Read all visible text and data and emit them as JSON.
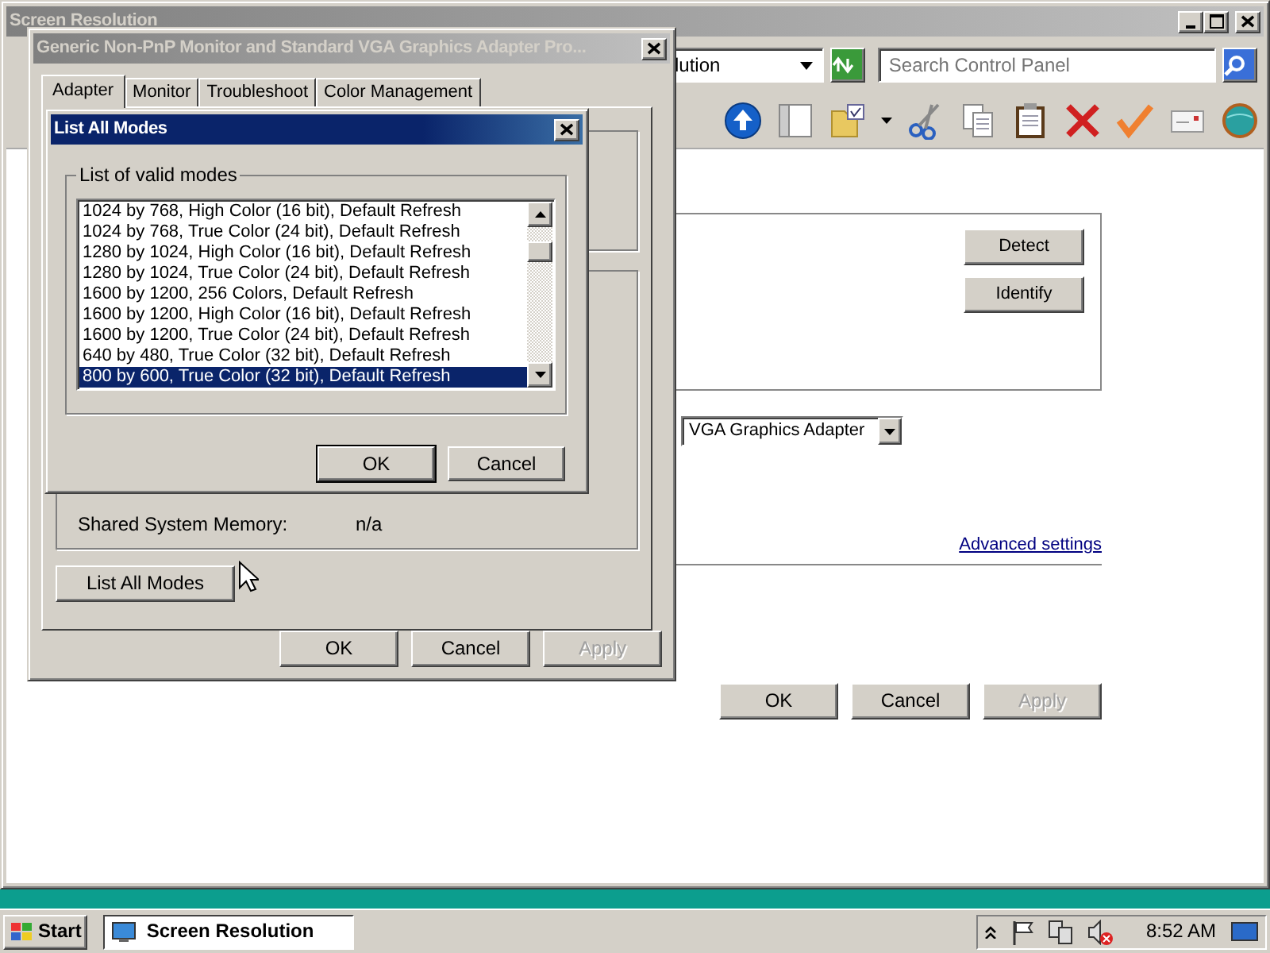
{
  "main_window": {
    "title": "Screen Resolution",
    "active": false,
    "address": "lution",
    "search": {
      "placeholder": "Search Control Panel"
    },
    "detect_button": "Detect",
    "identify_button": "Identify",
    "adapter_dropdown": "VGA Graphics Adapter",
    "advanced_link": "Advanced settings",
    "buttons": [
      {
        "label": "OK",
        "disabled": false
      },
      {
        "label": "Cancel",
        "disabled": false
      },
      {
        "label": "Apply",
        "disabled": true
      }
    ]
  },
  "properties_dialog": {
    "title": "Generic Non-PnP Monitor and Standard VGA Graphics Adapter Pro...",
    "active": false,
    "tabs": [
      {
        "label": "Adapter",
        "selected": true
      },
      {
        "label": "Monitor",
        "selected": false
      },
      {
        "label": "Troubleshoot",
        "selected": false
      },
      {
        "label": "Color Management",
        "selected": false
      }
    ],
    "info": [
      {
        "label": "Shared System Memory:",
        "value": "n/a"
      }
    ],
    "list_modes_button": "List All Modes",
    "buttons": [
      {
        "label": "OK",
        "disabled": false
      },
      {
        "label": "Cancel",
        "disabled": false
      },
      {
        "label": "Apply",
        "disabled": true
      }
    ]
  },
  "modes_dialog": {
    "title": "List All Modes",
    "active": true,
    "group_label": "List of valid modes",
    "modes": [
      {
        "label": "1024 by 768, High Color (16 bit), Default Refresh",
        "selected": false
      },
      {
        "label": "1024 by 768, True Color (24 bit), Default Refresh",
        "selected": false
      },
      {
        "label": "1280 by 1024, High Color (16 bit), Default Refresh",
        "selected": false
      },
      {
        "label": "1280 by 1024, True Color (24 bit), Default Refresh",
        "selected": false
      },
      {
        "label": "1600 by 1200, 256 Colors, Default Refresh",
        "selected": false
      },
      {
        "label": "1600 by 1200, High Color (16 bit), Default Refresh",
        "selected": false
      },
      {
        "label": "1600 by 1200, True Color (24 bit), Default Refresh",
        "selected": false
      },
      {
        "label": "640 by 480, True Color (32 bit), Default Refresh",
        "selected": false
      },
      {
        "label": "800 by 600, True Color (32 bit), Default Refresh",
        "selected": true
      }
    ],
    "buttons": [
      {
        "label": "OK",
        "default": true
      },
      {
        "label": "Cancel",
        "default": false
      }
    ]
  },
  "taskbar": {
    "start": "Start",
    "tasks": [
      {
        "label": "Screen Resolution",
        "active": true
      }
    ],
    "clock": "8:52 AM"
  }
}
